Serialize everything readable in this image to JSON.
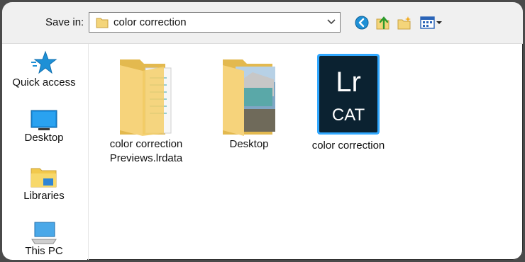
{
  "toolbar": {
    "save_in_label": "Save in:",
    "location_value": "color correction",
    "icons": [
      "back-icon",
      "up-folder-icon",
      "new-folder-icon",
      "view-menu-icon"
    ]
  },
  "sidebar": {
    "items": [
      {
        "label": "Quick access",
        "icon": "star-icon"
      },
      {
        "label": "Desktop",
        "icon": "desktop-icon"
      },
      {
        "label": "Libraries",
        "icon": "libraries-icon"
      },
      {
        "label": "This PC",
        "icon": "computer-icon"
      }
    ]
  },
  "files": [
    {
      "label_line1": "color correction",
      "label_line2": "Previews.lrdata",
      "icon": "folder-icon"
    },
    {
      "label_line1": "Desktop",
      "icon": "folder-icon"
    },
    {
      "label_line1": "color correction",
      "icon": "lightroom-catalog-icon",
      "badge_top": "Lr",
      "badge_bottom": "CAT"
    }
  ],
  "colors": {
    "accent": "#1e90d6",
    "folder": "#f4d57a",
    "lr_badge_bg": "#0b2231",
    "lr_badge_border": "#31a8ff"
  }
}
